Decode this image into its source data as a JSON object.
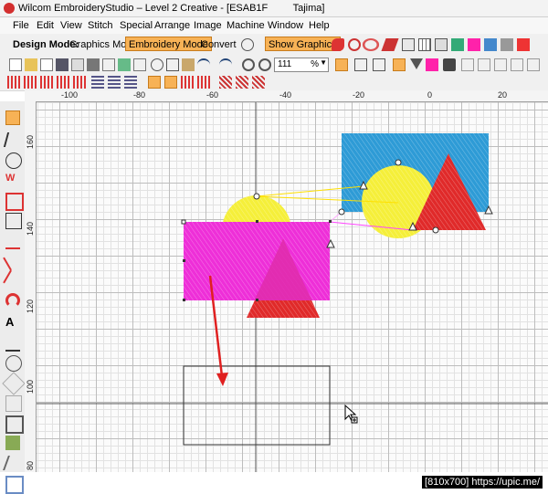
{
  "window": {
    "title": "Wilcom EmbroideryStudio – Level 2 Creative - [ESAB1F         Tajima]"
  },
  "menu": [
    {
      "label": "File"
    },
    {
      "label": "Edit"
    },
    {
      "label": "View"
    },
    {
      "label": "Stitch"
    },
    {
      "label": "Special"
    },
    {
      "label": "Arrange"
    },
    {
      "label": "Image"
    },
    {
      "label": "Machine"
    },
    {
      "label": "Window"
    },
    {
      "label": "Help"
    }
  ],
  "toolbar": {
    "design_mode_label": "Design Mode:",
    "graphics_mode": "Graphics Mode",
    "embroidery_mode": "Embroidery Mode",
    "convert": "Convert",
    "show_graphics": "Show Graphics",
    "zoom_value": "111",
    "zoom_unit": "%"
  },
  "ruler": {
    "top": [
      "-100",
      "-80",
      "-60",
      "-40",
      "-20",
      "0",
      "20"
    ],
    "left": [
      "160",
      "140",
      "120",
      "100",
      "80"
    ]
  },
  "colors": {
    "active_button": "#f7b256",
    "selection_arrow": "#e02020",
    "shape_blue": "#2e9bd6",
    "shape_yellow": "#f5ef3a",
    "shape_red": "#e02a2a",
    "shape_magenta": "#ee2fd8"
  },
  "watermark": "[810x700] https://upic.me/"
}
